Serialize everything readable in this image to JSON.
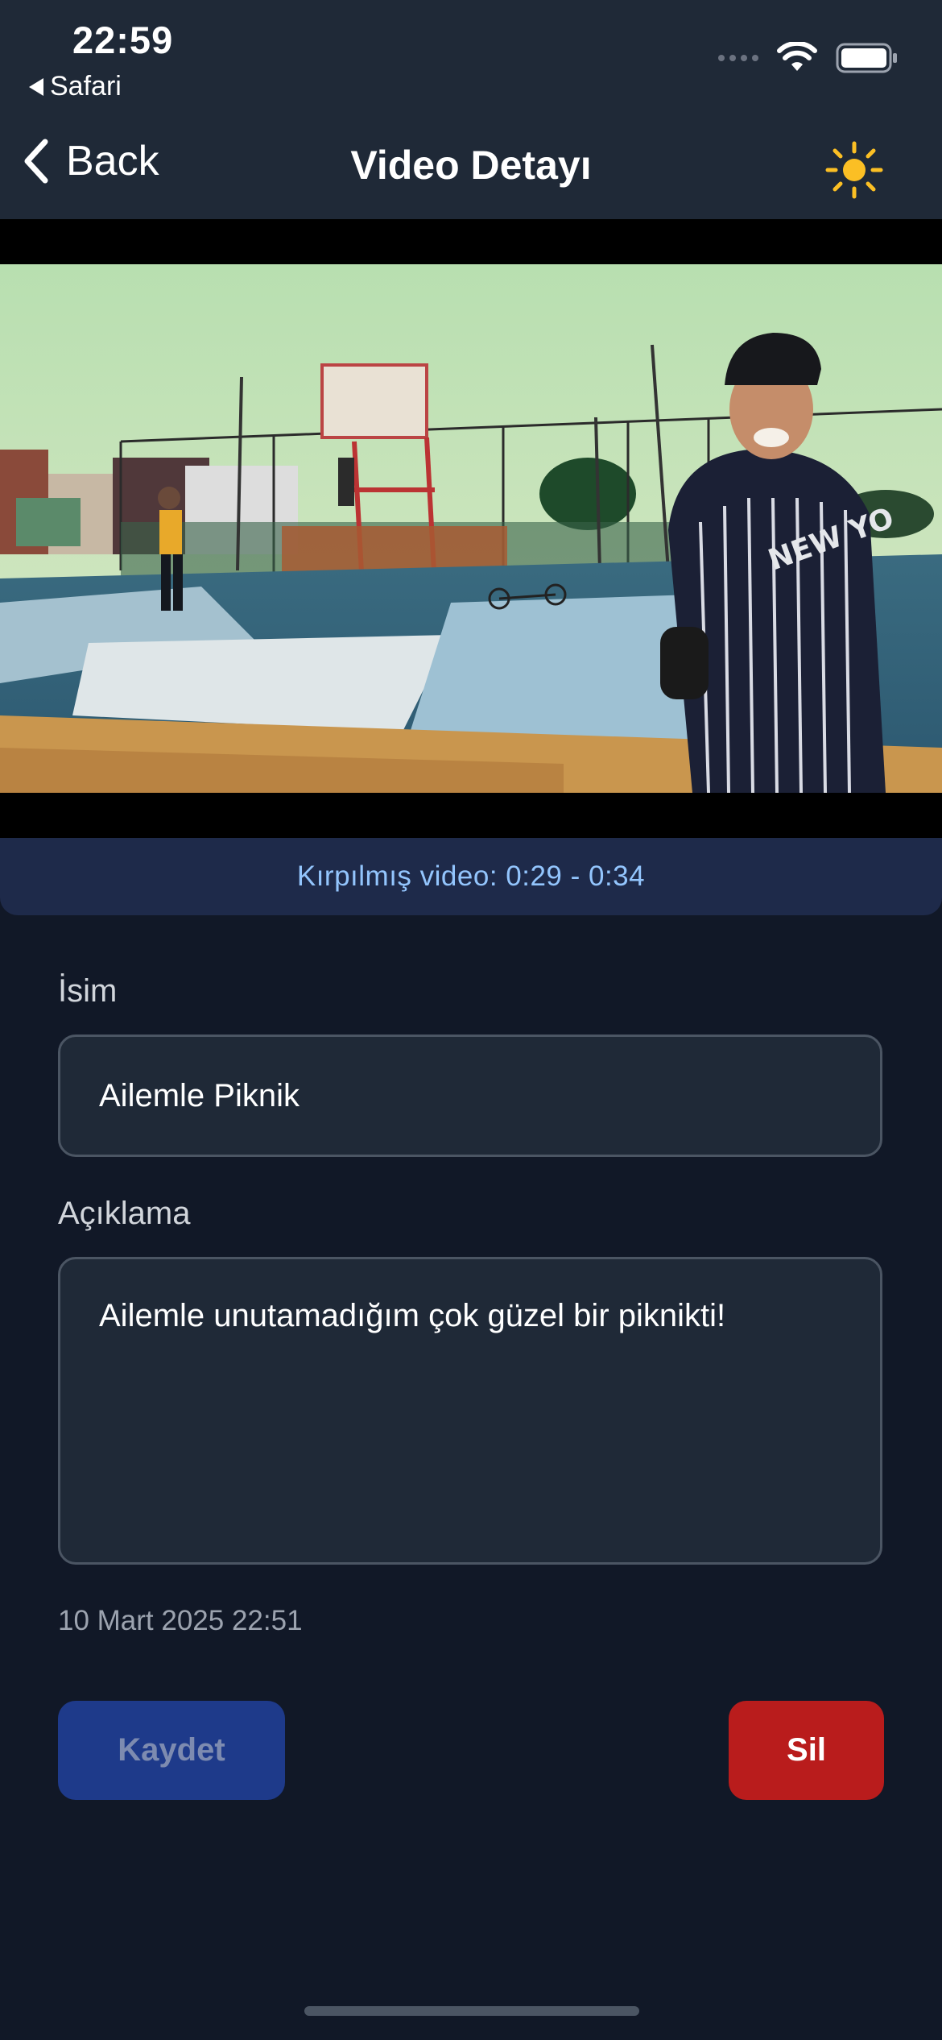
{
  "status_bar": {
    "time": "22:59",
    "back_app": "Safari"
  },
  "nav": {
    "back_label": "Back",
    "title": "Video Detayı",
    "theme_icon": "sun-icon"
  },
  "video": {
    "trim_text": "Kırpılmış video: 0:29 - 0:34"
  },
  "form": {
    "name_label": "İsim",
    "name_value": "Ailemle Piknik",
    "description_label": "Açıklama",
    "description_value": "Ailemle unutamadığım çok güzel bir piknikti!",
    "date": "10 Mart 2025 22:51"
  },
  "actions": {
    "save_label": "Kaydet",
    "delete_label": "Sil"
  },
  "colors": {
    "background": "#111827",
    "topbar": "#1f2937",
    "accent_sun": "#fbbf24",
    "trim_text": "#93c5fd",
    "save_button": "#1e3a8a",
    "delete_button": "#b91c1c"
  }
}
